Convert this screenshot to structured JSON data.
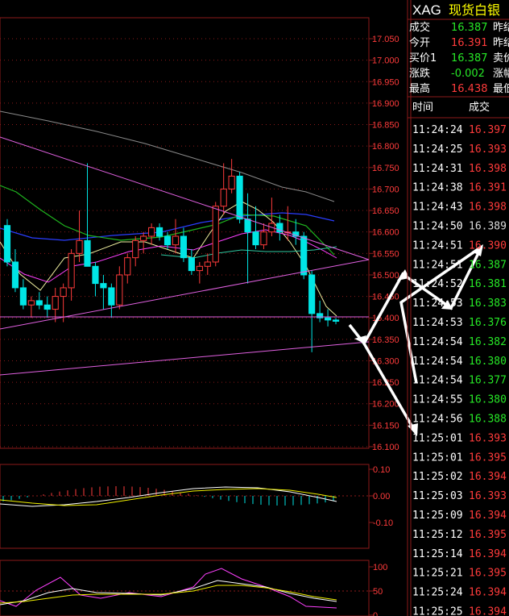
{
  "header": {
    "symbol": "XAG",
    "name": "现货白银"
  },
  "quote": [
    {
      "label": "成交",
      "value": "16.387",
      "color": "#27e827",
      "next": "昨结"
    },
    {
      "label": "今开",
      "value": "16.391",
      "color": "#ff3b3b",
      "next": "昨结"
    },
    {
      "label": "买价1",
      "value": "16.387",
      "color": "#27e827",
      "next": "卖价"
    },
    {
      "label": "涨跌",
      "value": "-0.002",
      "color": "#27e827",
      "next": "涨幅"
    },
    {
      "label": "最高",
      "value": "16.438",
      "color": "#ff3b3b",
      "next": "最低"
    }
  ],
  "ticks_header": {
    "time": "时间",
    "price": "成交"
  },
  "ticks": [
    {
      "time": "11:24:24",
      "price": "16.397",
      "color": "#ff3b3b"
    },
    {
      "time": "11:24:25",
      "price": "16.393",
      "color": "#ff3b3b"
    },
    {
      "time": "11:24:31",
      "price": "16.398",
      "color": "#ff3b3b"
    },
    {
      "time": "11:24:38",
      "price": "16.391",
      "color": "#ff3b3b"
    },
    {
      "time": "11:24:43",
      "price": "16.398",
      "color": "#ff3b3b"
    },
    {
      "time": "11:24:50",
      "price": "16.389",
      "color": "#dddddd"
    },
    {
      "time": "11:24:51",
      "price": "16.390",
      "color": "#ff3b3b"
    },
    {
      "time": "11:24:51",
      "price": "16.387",
      "color": "#27e827"
    },
    {
      "time": "11:24:52",
      "price": "16.381",
      "color": "#27e827"
    },
    {
      "time": "11:24:53",
      "price": "16.383",
      "color": "#27e827"
    },
    {
      "time": "11:24:53",
      "price": "16.376",
      "color": "#27e827"
    },
    {
      "time": "11:24:54",
      "price": "16.382",
      "color": "#27e827"
    },
    {
      "time": "11:24:54",
      "price": "16.380",
      "color": "#27e827"
    },
    {
      "time": "11:24:54",
      "price": "16.377",
      "color": "#27e827"
    },
    {
      "time": "11:24:55",
      "price": "16.380",
      "color": "#27e827"
    },
    {
      "time": "11:24:56",
      "price": "16.388",
      "color": "#27e827"
    },
    {
      "time": "11:25:01",
      "price": "16.393",
      "color": "#ff3b3b"
    },
    {
      "time": "11:25:01",
      "price": "16.395",
      "color": "#ff3b3b"
    },
    {
      "time": "11:25:02",
      "price": "16.394",
      "color": "#ff3b3b"
    },
    {
      "time": "11:25:03",
      "price": "16.393",
      "color": "#ff3b3b"
    },
    {
      "time": "11:25:09",
      "price": "16.394",
      "color": "#ff3b3b"
    },
    {
      "time": "11:25:12",
      "price": "16.395",
      "color": "#ff3b3b"
    },
    {
      "time": "11:25:14",
      "price": "16.394",
      "color": "#ff3b3b"
    },
    {
      "time": "11:25:21",
      "price": "16.395",
      "color": "#ff3b3b"
    },
    {
      "time": "11:25:24",
      "price": "16.394",
      "color": "#ff3b3b"
    },
    {
      "time": "11:25:25",
      "price": "16.394",
      "color": "#ff3b3b"
    }
  ],
  "colors": {
    "up": "#ff3b3b",
    "down": "#00e5e5",
    "grid": "#8b1a1a",
    "trend": "#e060e0"
  },
  "chart_data": [
    {
      "type": "candlestick",
      "ylim": [
        16.1,
        17.05
      ],
      "yticks": [
        "16.100",
        "16.150",
        "16.200",
        "16.250",
        "16.300",
        "16.350",
        "16.400",
        "16.450",
        "16.500",
        "16.550",
        "16.600",
        "16.650",
        "16.700",
        "16.750",
        "16.800",
        "16.850",
        "16.900",
        "16.950",
        "17.000",
        "17.050"
      ],
      "candles": [
        [
          16.615,
          16.63,
          16.52,
          16.53
        ],
        [
          16.53,
          16.56,
          16.46,
          16.47
        ],
        [
          16.47,
          16.49,
          16.42,
          16.43
        ],
        [
          16.43,
          16.45,
          16.4,
          16.44
        ],
        [
          16.44,
          16.46,
          16.42,
          16.43
        ],
        [
          16.43,
          16.45,
          16.4,
          16.42
        ],
        [
          16.42,
          16.47,
          16.39,
          16.45
        ],
        [
          16.45,
          16.48,
          16.39,
          16.47
        ],
        [
          16.47,
          16.56,
          16.44,
          16.55
        ],
        [
          16.55,
          16.65,
          16.53,
          16.58
        ],
        [
          16.58,
          16.76,
          16.56,
          16.52
        ],
        [
          16.52,
          16.53,
          16.45,
          16.48
        ],
        [
          16.48,
          16.5,
          16.42,
          16.47
        ],
        [
          16.47,
          16.48,
          16.4,
          16.43
        ],
        [
          16.43,
          16.52,
          16.42,
          16.5
        ],
        [
          16.5,
          16.55,
          16.48,
          16.54
        ],
        [
          16.54,
          16.59,
          16.52,
          16.58
        ],
        [
          16.58,
          16.6,
          16.55,
          16.59
        ],
        [
          16.59,
          16.62,
          16.57,
          16.61
        ],
        [
          16.61,
          16.62,
          16.58,
          16.59
        ],
        [
          16.59,
          16.6,
          16.56,
          16.57
        ],
        [
          16.57,
          16.63,
          16.55,
          16.59
        ],
        [
          16.59,
          16.61,
          16.53,
          16.54
        ],
        [
          16.54,
          16.56,
          16.5,
          16.51
        ],
        [
          16.51,
          16.53,
          16.48,
          16.52
        ],
        [
          16.52,
          16.55,
          16.5,
          16.53
        ],
        [
          16.53,
          16.67,
          16.52,
          16.66
        ],
        [
          16.66,
          16.76,
          16.64,
          16.7
        ],
        [
          16.7,
          16.77,
          16.69,
          16.73
        ],
        [
          16.73,
          16.74,
          16.62,
          16.63
        ],
        [
          16.63,
          16.69,
          16.48,
          16.6
        ],
        [
          16.6,
          16.66,
          16.56,
          16.57
        ],
        [
          16.57,
          16.62,
          16.56,
          16.6
        ],
        [
          16.6,
          16.68,
          16.59,
          16.62
        ],
        [
          16.62,
          16.64,
          16.58,
          16.6
        ],
        [
          16.6,
          16.66,
          16.58,
          16.6
        ],
        [
          16.6,
          16.63,
          16.57,
          16.59
        ],
        [
          16.59,
          16.6,
          16.49,
          16.5
        ],
        [
          16.5,
          16.51,
          16.32,
          16.41
        ],
        [
          16.41,
          16.44,
          16.39,
          16.4
        ],
        [
          16.4,
          16.42,
          16.38,
          16.395
        ],
        [
          16.395,
          16.4,
          16.385,
          16.392
        ]
      ]
    },
    {
      "type": "macd",
      "ylim": [
        -0.1,
        0.1
      ],
      "yticks": [
        "0.10",
        "0.00",
        "-0.10"
      ]
    },
    {
      "type": "kdj",
      "ylim": [
        0,
        100
      ],
      "yticks": [
        "100",
        "50",
        "0"
      ]
    }
  ]
}
